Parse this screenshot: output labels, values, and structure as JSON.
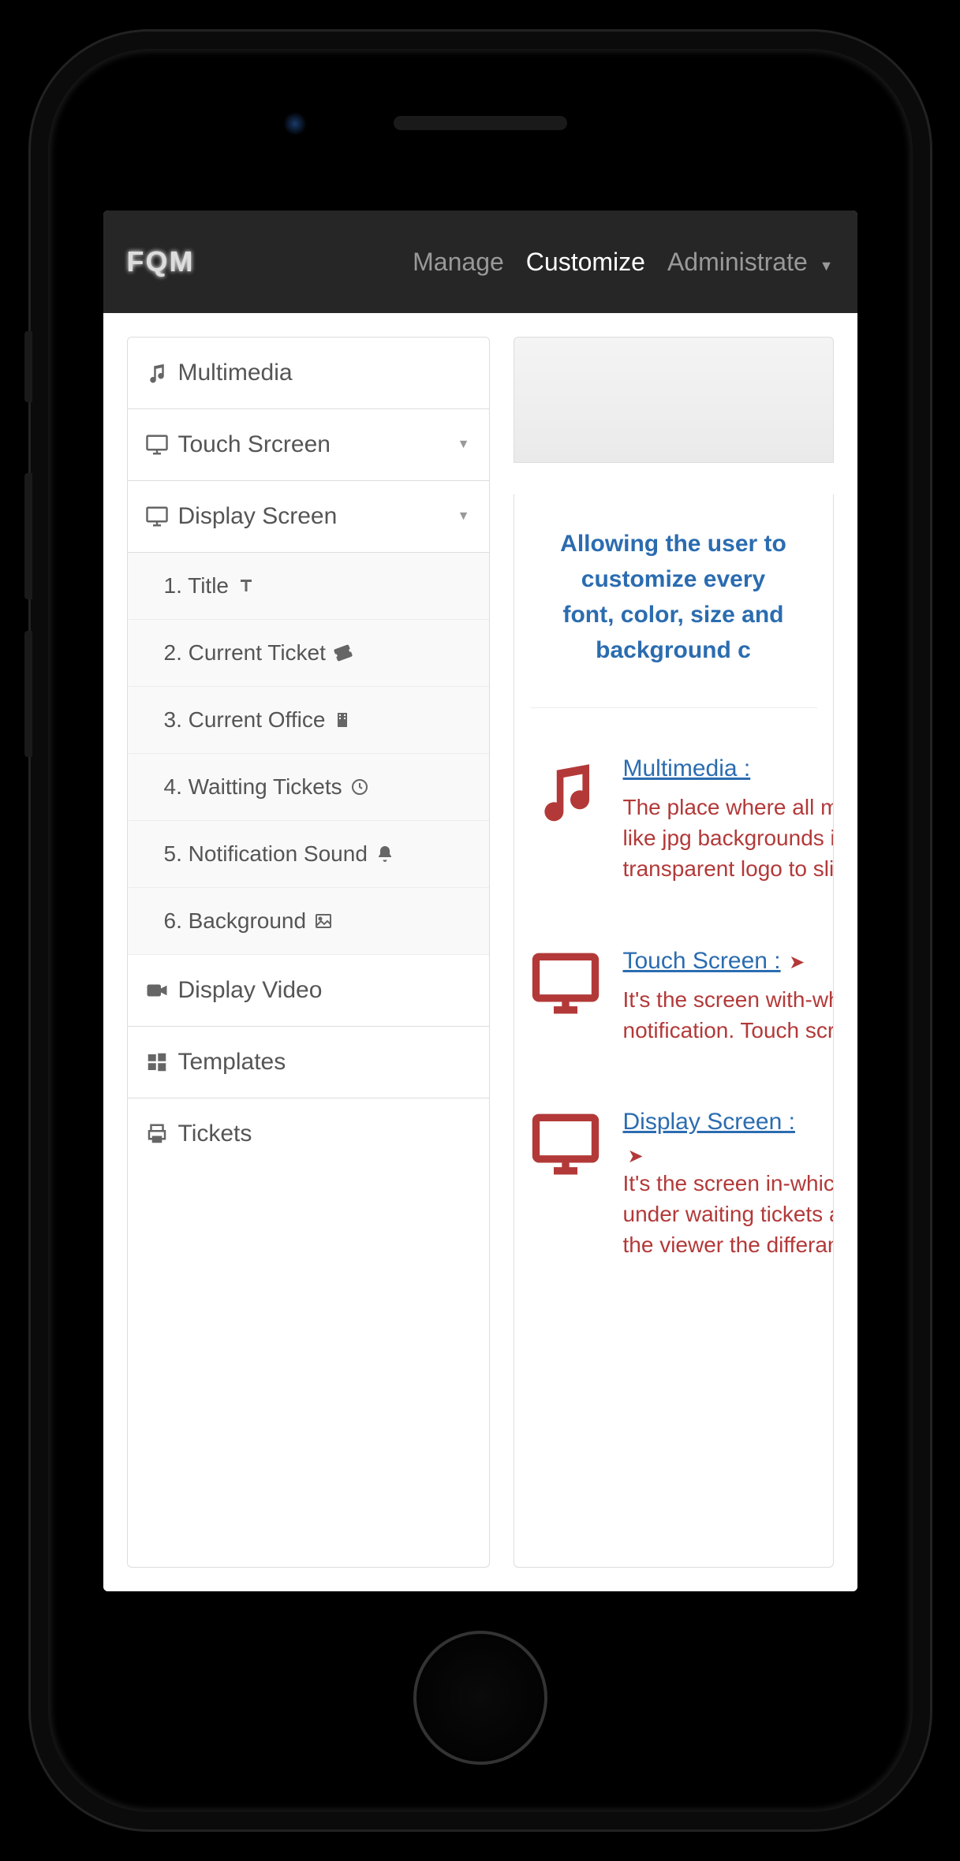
{
  "brand": "FQM",
  "nav": {
    "manage": "Manage",
    "customize": "Customize",
    "administrate": "Administrate"
  },
  "sidebar": {
    "multimedia": "Multimedia",
    "touch_screen": "Touch Srcreen",
    "display_screen": "Display Screen",
    "subs": {
      "title": "1. Title",
      "current_ticket": "2. Current Ticket",
      "current_office": "3. Current Office",
      "waiting_tickets": "4. Waitting Tickets",
      "notification_sound": "5. Notification Sound",
      "background": "6. Background"
    },
    "display_video": "Display Video",
    "templates": "Templates",
    "tickets": "Tickets"
  },
  "main": {
    "lead_line1": "Allowing the user to customize every",
    "lead_line2": "font, color, size and background c",
    "blocks": {
      "multimedia": {
        "title": "Multimedia :",
        "desc1": "The place where all multimedia",
        "desc2": "like jpg backgrounds instead of",
        "desc3": "transparent logo to slides for ex"
      },
      "touch": {
        "title": "Touch Screen :",
        "desc1": "It's the screen with-which the c",
        "desc2": "notification. Touch screen purp"
      },
      "display": {
        "title": "Display Screen :",
        "desc1": "It's the screen in-which tickets",
        "desc2": "under waiting tickets and each",
        "desc3": "the viewer the differance in-be"
      }
    }
  }
}
